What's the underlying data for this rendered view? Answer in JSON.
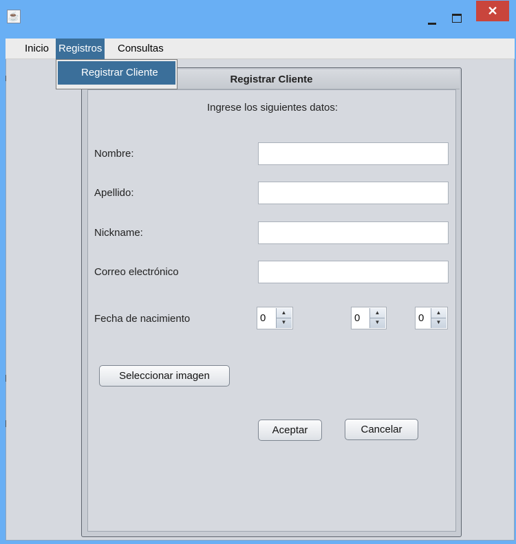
{
  "window": {
    "title": "",
    "controls": {
      "minimize_icon": "minimize-icon",
      "maximize_icon": "maximize-icon",
      "close_symbol": "✕"
    }
  },
  "menubar": {
    "items": [
      {
        "label": "Inicio"
      },
      {
        "label": "Registros"
      },
      {
        "label": "Consultas"
      }
    ],
    "open_menu": "Registros",
    "dropdown": {
      "items": [
        {
          "label": "Registrar Cliente"
        }
      ]
    }
  },
  "dialog": {
    "title": "Registrar Cliente",
    "instructions": "Ingrese los siguientes datos:",
    "fields": {
      "nombre": {
        "label": "Nombre:",
        "value": ""
      },
      "apellido": {
        "label": "Apellido:",
        "value": ""
      },
      "nickname": {
        "label": "Nickname:",
        "value": ""
      },
      "correo": {
        "label": "Correo electrónico",
        "value": ""
      }
    },
    "birthdate": {
      "label": "Fecha de nacimiento",
      "day": "0",
      "month": "0",
      "year": "0"
    },
    "select_image_label": "Seleccionar imagen",
    "accept_label": "Aceptar",
    "cancel_label": "Cancelar"
  },
  "colors": {
    "title_bar": "#69aff4",
    "menu_highlight": "#3b6f9a",
    "close_button": "#c9453c",
    "panel_background": "#d6d9df"
  }
}
